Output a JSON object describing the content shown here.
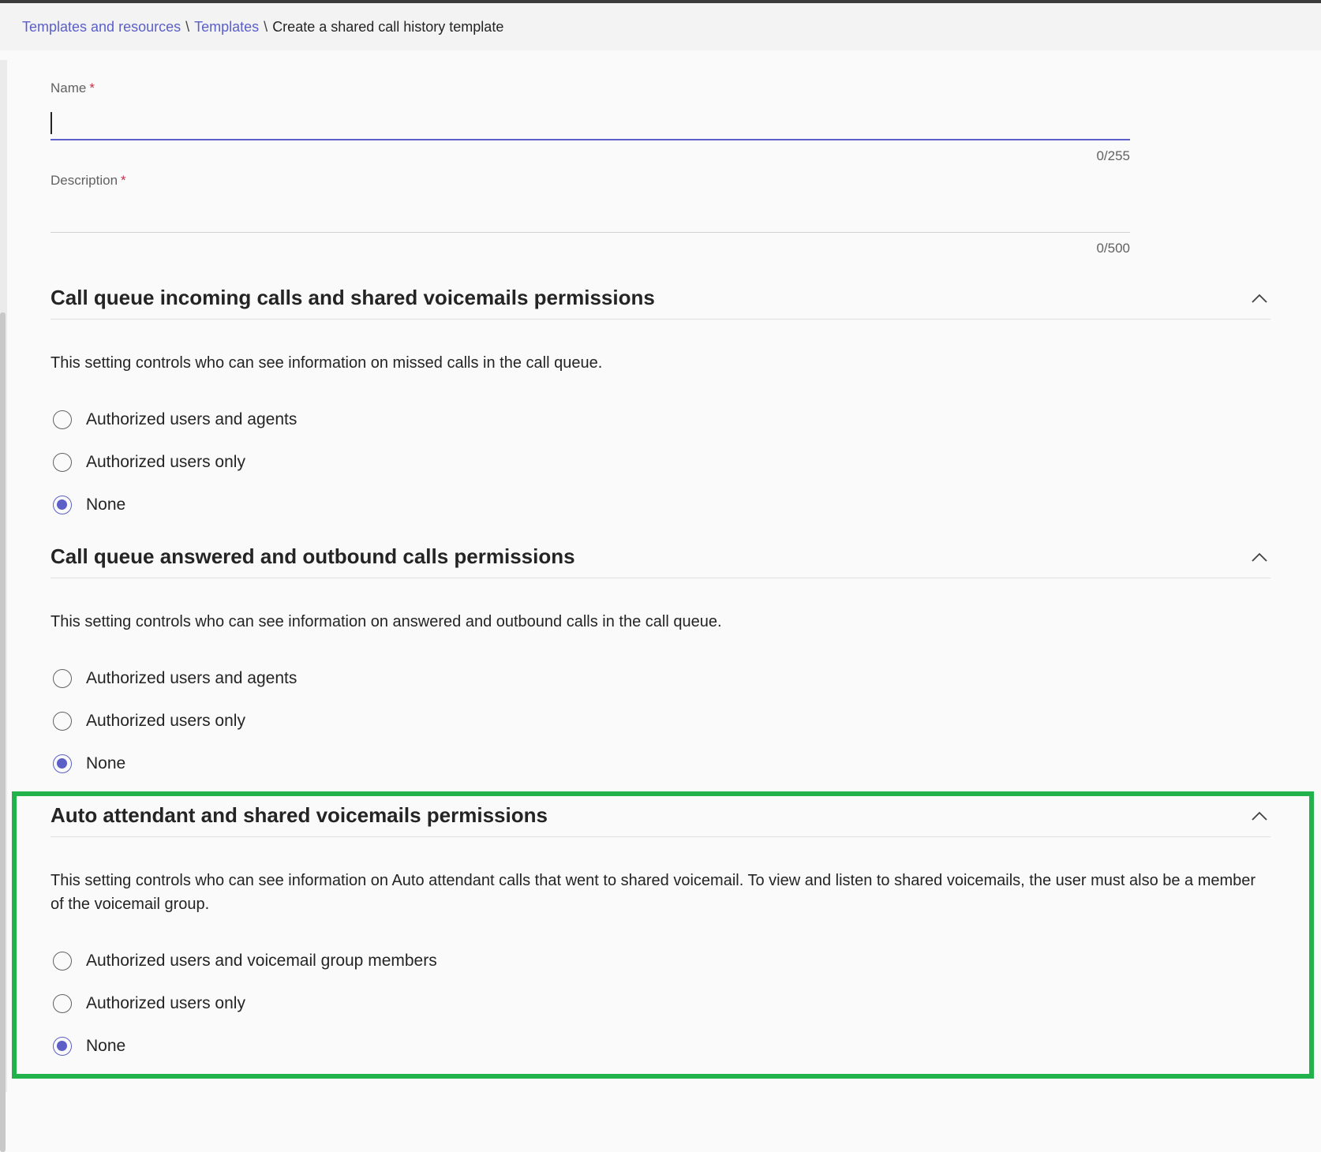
{
  "breadcrumb": {
    "item1": "Templates and resources",
    "item2": "Templates",
    "separator": "\\",
    "current": "Create a shared call history template"
  },
  "form": {
    "name": {
      "label": "Name",
      "required_mark": "*",
      "value": "",
      "counter": "0/255"
    },
    "description": {
      "label": "Description",
      "required_mark": "*",
      "value": "",
      "counter": "0/500"
    }
  },
  "sections": [
    {
      "title": "Call queue incoming calls and shared voicemails permissions",
      "description": "This setting controls who can see information on missed calls in the call queue.",
      "options": [
        "Authorized users and agents",
        "Authorized users only",
        "None"
      ],
      "selected": "None"
    },
    {
      "title": "Call queue answered and outbound calls permissions",
      "description": "This setting controls who can see information on answered and outbound calls in the call queue.",
      "options": [
        "Authorized users and agents",
        "Authorized users only",
        "None"
      ],
      "selected": "None"
    },
    {
      "title": "Auto attendant and shared voicemails permissions",
      "description": "This setting controls who can see information on Auto attendant calls that went to shared voicemail. To view and listen to shared voicemails, the user must also be a member of the voicemail group.",
      "options": [
        "Authorized users and voicemail group members",
        "Authorized users only",
        "None"
      ],
      "selected": "None"
    }
  ],
  "colors": {
    "accent": "#5b5fc7",
    "required": "#c4314b",
    "highlight": "#22b24c"
  },
  "icons": {
    "collapse": "chevron-up-icon",
    "radio_checked": "radio-checked-icon",
    "radio_unchecked": "radio-unchecked-icon"
  }
}
